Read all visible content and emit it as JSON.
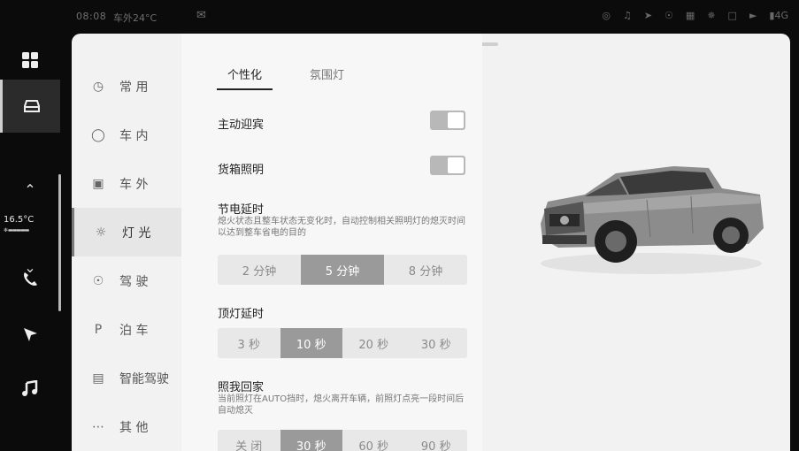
{
  "status": {
    "time": "08:08",
    "outside_temp": "车外24°C",
    "signal": "4G"
  },
  "dock": {
    "climate_temp": "16.5°C"
  },
  "menu": {
    "items": [
      {
        "label": "常 用",
        "icon": "gauge-icon"
      },
      {
        "label": "车 内",
        "icon": "car-interior-icon"
      },
      {
        "label": "车 外",
        "icon": "car-exterior-icon"
      },
      {
        "label": "灯 光",
        "icon": "light-icon"
      },
      {
        "label": "驾 驶",
        "icon": "steering-icon"
      },
      {
        "label": "泊 车",
        "icon": "parking-icon"
      },
      {
        "label": "智能驾驶",
        "icon": "smart-drive-icon"
      },
      {
        "label": "其 他",
        "icon": "more-icon"
      }
    ]
  },
  "tabs": [
    "个性化",
    "氛围灯"
  ],
  "settings": {
    "welcome": {
      "title": "主动迎宾",
      "on": true
    },
    "cargo_light": {
      "title": "货箱照明",
      "on": true
    },
    "power_delay": {
      "title": "节电延时",
      "desc": "熄火状态且整车状态无变化时，自动控制相关照明灯的熄灭时间以达到整车省电的目的",
      "options": [
        "2 分钟",
        "5 分钟",
        "8 分钟"
      ],
      "selected": 1
    },
    "dome_delay": {
      "title": "顶灯延时",
      "options": [
        "3 秒",
        "10 秒",
        "20 秒",
        "30 秒"
      ],
      "selected": 1
    },
    "follow_me": {
      "title": "照我回家",
      "desc": "当前照灯在AUTO挡时，熄火离开车辆，前照灯点亮一段时间后自动熄灭",
      "options": [
        "关 闭",
        "30 秒",
        "60 秒",
        "90 秒"
      ],
      "selected": 1
    }
  }
}
